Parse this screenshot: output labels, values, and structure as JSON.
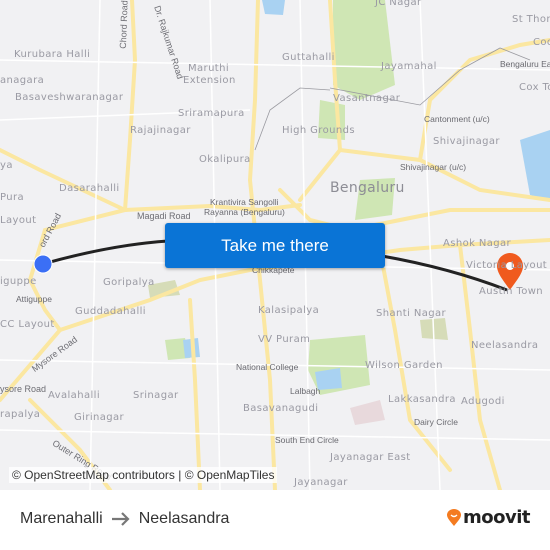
{
  "map": {
    "labels": [
      "Kurubara Halli",
      "anagara",
      "Basaveshwaranagar",
      "Chord Road",
      "Dr. Rajkumar Road",
      "Maruthi",
      "Extension",
      "Sriramapura",
      "Rajajinagar",
      "Okalipura",
      "ya",
      "Dasarahalli",
      "Pura",
      "Layout",
      "ord Road",
      "Magadi Road",
      "Krantivira Sangolli",
      "Rayanna (Bengaluru)",
      "JC Nagar",
      "Guttahalli",
      "Jayamahal",
      "Vasantnagar",
      "High Grounds",
      "Cantonment (u/c)",
      "Shivajinagar",
      "Shivajinagar (u/c)",
      "Bengaluru",
      "St Thom",
      "Coo",
      "Bengaluru Ea",
      "Cox To",
      "Ashok Nagar",
      "Victoria Layout",
      "Austin Town",
      "Chikkapete",
      "iguppe",
      "Attiguppe",
      "Goripalya",
      "Guddadahalli",
      "CC Layout",
      "Mysore Road",
      "Kalasipalya",
      "Shanti Nagar",
      "VV Puram",
      "Neelasandra",
      "National College",
      "Wilson Garden",
      "Lalbagh",
      "ysore Road",
      "Avalahalli",
      "Srinagar",
      "Basavanagudi",
      "Lakkasandra",
      "Adugodi",
      "rapalya",
      "Girinagar",
      "Dairy Circle",
      "South End Circle",
      "Jayanagar East",
      "Outer Ring Road",
      "Jayanagar"
    ],
    "origin_color": "#3b6ff5",
    "destination_color": "#f05a1e",
    "route_color": "#222222",
    "attribution": "© OpenStreetMap contributors | © OpenMapTiles"
  },
  "button": {
    "label": "Take me there",
    "color": "#0a74d6"
  },
  "footer": {
    "origin": "Marenahalli",
    "arrow_icon": "arrow-right-icon",
    "destination": "Neelasandra",
    "brand": "moovit",
    "brand_color": "#f47b20"
  }
}
